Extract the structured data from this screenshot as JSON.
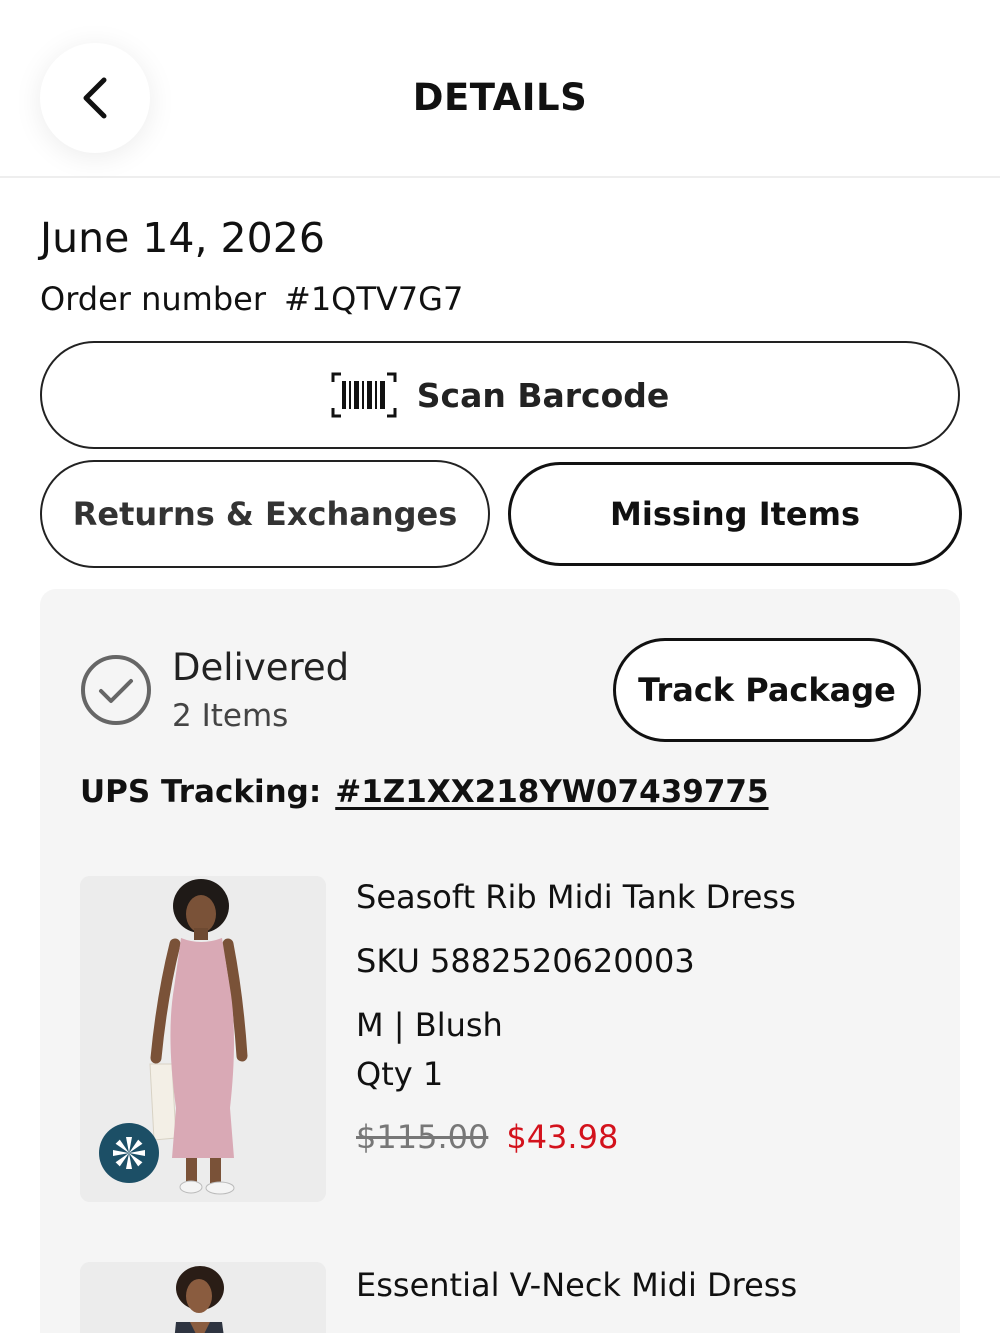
{
  "header": {
    "title": "DETAILS"
  },
  "order": {
    "date": "June 14, 2026",
    "number_label": "Order number",
    "number": "#1QTV7G7"
  },
  "actions": {
    "scan_barcode": "Scan Barcode",
    "returns_exchanges": "Returns & Exchanges",
    "missing_items": "Missing Items"
  },
  "shipment": {
    "status": "Delivered",
    "item_count": "2 Items",
    "track_package": "Track Package",
    "tracking_label": "UPS Tracking:",
    "tracking_number": "#1Z1XX218YW07439775",
    "items": [
      {
        "name": "Seasoft Rib Midi Tank Dress",
        "sku": "SKU 5882520620003",
        "variant": "M | Blush",
        "qty": "Qty 1",
        "original_price": "$115.00",
        "sale_price": "$43.98"
      },
      {
        "name": "Essential V-Neck Midi Dress"
      }
    ]
  },
  "colors": {
    "sale_price": "#d3121c",
    "badge": "#1c4f66",
    "card_bg": "#f5f5f5",
    "dress_pink": "#d9a9b5"
  }
}
